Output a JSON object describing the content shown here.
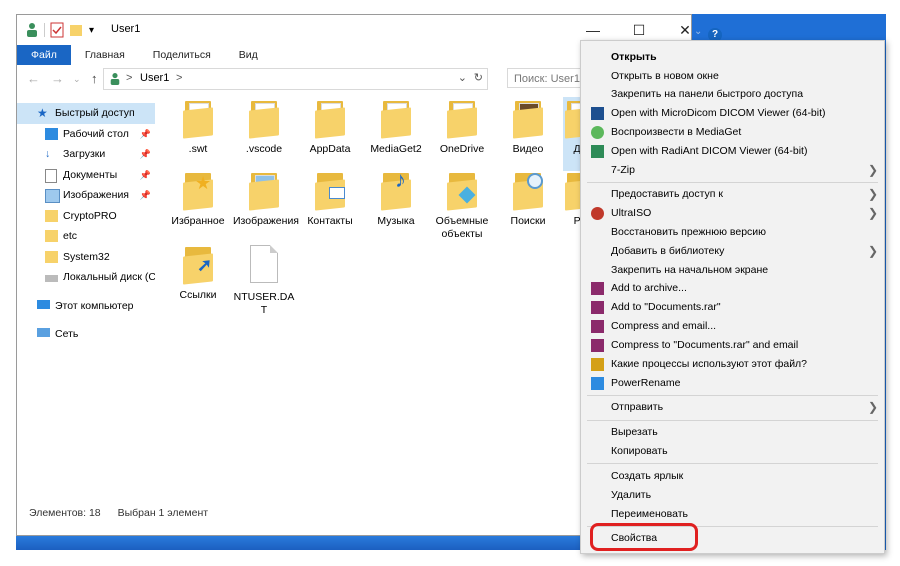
{
  "window": {
    "title": "User1",
    "qa_dropdown": "▾"
  },
  "controls": {
    "minimize": "—",
    "maximize": "☐",
    "close": "✕"
  },
  "ribbon": {
    "tabs": [
      "Файл",
      "Главная",
      "Поделиться",
      "Вид"
    ]
  },
  "address": {
    "path": "User1",
    "separator": ">",
    "search_placeholder": "Поиск: User1"
  },
  "nav": {
    "items": [
      {
        "label": "Быстрый доступ",
        "icon": "star-icon",
        "top": true
      },
      {
        "label": "Рабочий стол",
        "icon": "desktop-icon",
        "pinned": true
      },
      {
        "label": "Загрузки",
        "icon": "download-icon",
        "pinned": true
      },
      {
        "label": "Документы",
        "icon": "document-icon",
        "pinned": true
      },
      {
        "label": "Изображения",
        "icon": "pictures-icon",
        "pinned": true
      },
      {
        "label": "CryptoPRO",
        "icon": "folder-icon"
      },
      {
        "label": "etc",
        "icon": "folder-icon"
      },
      {
        "label": "System32",
        "icon": "folder-icon"
      },
      {
        "label": "Локальный диск (C",
        "icon": "drive-icon"
      },
      {
        "label": "Этот компьютер",
        "icon": "computer-icon",
        "top": true
      },
      {
        "label": "Сеть",
        "icon": "network-icon",
        "top": true
      }
    ]
  },
  "files": [
    {
      "label": ".swt",
      "kind": "folder"
    },
    {
      "label": ".vscode",
      "kind": "folder"
    },
    {
      "label": "AppData",
      "kind": "folder"
    },
    {
      "label": "MediaGet2",
      "kind": "folder"
    },
    {
      "label": "OneDrive",
      "kind": "folder"
    },
    {
      "label": "Видео",
      "kind": "folder"
    },
    {
      "label": "До",
      "kind": "folder",
      "selected": true
    },
    {
      "label": "Избранное",
      "kind": "folder"
    },
    {
      "label": "Изображения",
      "kind": "folder"
    },
    {
      "label": "Контакты",
      "kind": "folder"
    },
    {
      "label": "Музыка",
      "kind": "folder"
    },
    {
      "label": "Объемные объекты",
      "kind": "folder"
    },
    {
      "label": "Поиски",
      "kind": "folder"
    },
    {
      "label": "Pa",
      "kind": "folder"
    },
    {
      "label": "Ссылки",
      "kind": "folder"
    },
    {
      "label": "NTUSER.DAT",
      "kind": "file"
    }
  ],
  "status": {
    "count": "Элементов: 18",
    "selected": "Выбран 1 элемент"
  },
  "context_menu": {
    "items": [
      {
        "label": "Открыть",
        "bold": true
      },
      {
        "label": "Открыть в новом окне"
      },
      {
        "label": "Закрепить на панели быстрого доступа"
      },
      {
        "label": "Open with MicroDicom DICOM Viewer (64-bit)",
        "icon": "microdicom-icon"
      },
      {
        "label": "Воспроизвести в MediaGet",
        "icon": "mediaget-icon"
      },
      {
        "label": "Open with RadiAnt DICOM Viewer (64-bit)",
        "icon": "radiant-icon"
      },
      {
        "label": "7-Zip",
        "submenu": true
      },
      {
        "sep": true
      },
      {
        "label": "Предоставить доступ к",
        "submenu": true
      },
      {
        "label": "UltraISO",
        "icon": "ultraiso-icon",
        "submenu": true
      },
      {
        "label": "Восстановить прежнюю версию"
      },
      {
        "label": "Добавить в библиотеку",
        "submenu": true
      },
      {
        "label": "Закрепить на начальном экране"
      },
      {
        "label": "Add to archive...",
        "icon": "winrar-icon"
      },
      {
        "label": "Add to \"Documents.rar\"",
        "icon": "winrar-icon"
      },
      {
        "label": "Compress and email...",
        "icon": "winrar-icon"
      },
      {
        "label": "Compress to \"Documents.rar\" and email",
        "icon": "winrar-icon"
      },
      {
        "label": "Какие процессы используют этот файл?",
        "icon": "lock-icon"
      },
      {
        "label": "PowerRename",
        "icon": "powerrename-icon"
      },
      {
        "sep": true
      },
      {
        "label": "Отправить",
        "submenu": true
      },
      {
        "sep": true
      },
      {
        "label": "Вырезать"
      },
      {
        "label": "Копировать"
      },
      {
        "sep": true
      },
      {
        "label": "Создать ярлык"
      },
      {
        "label": "Удалить"
      },
      {
        "label": "Переименовать"
      },
      {
        "sep": true
      },
      {
        "label": "Свойства",
        "highlighted": true
      }
    ]
  },
  "colors": {
    "accent": "#1a66c4",
    "highlight": "#e02020",
    "selection": "#cce4f7",
    "folder": "#f7d26a"
  }
}
